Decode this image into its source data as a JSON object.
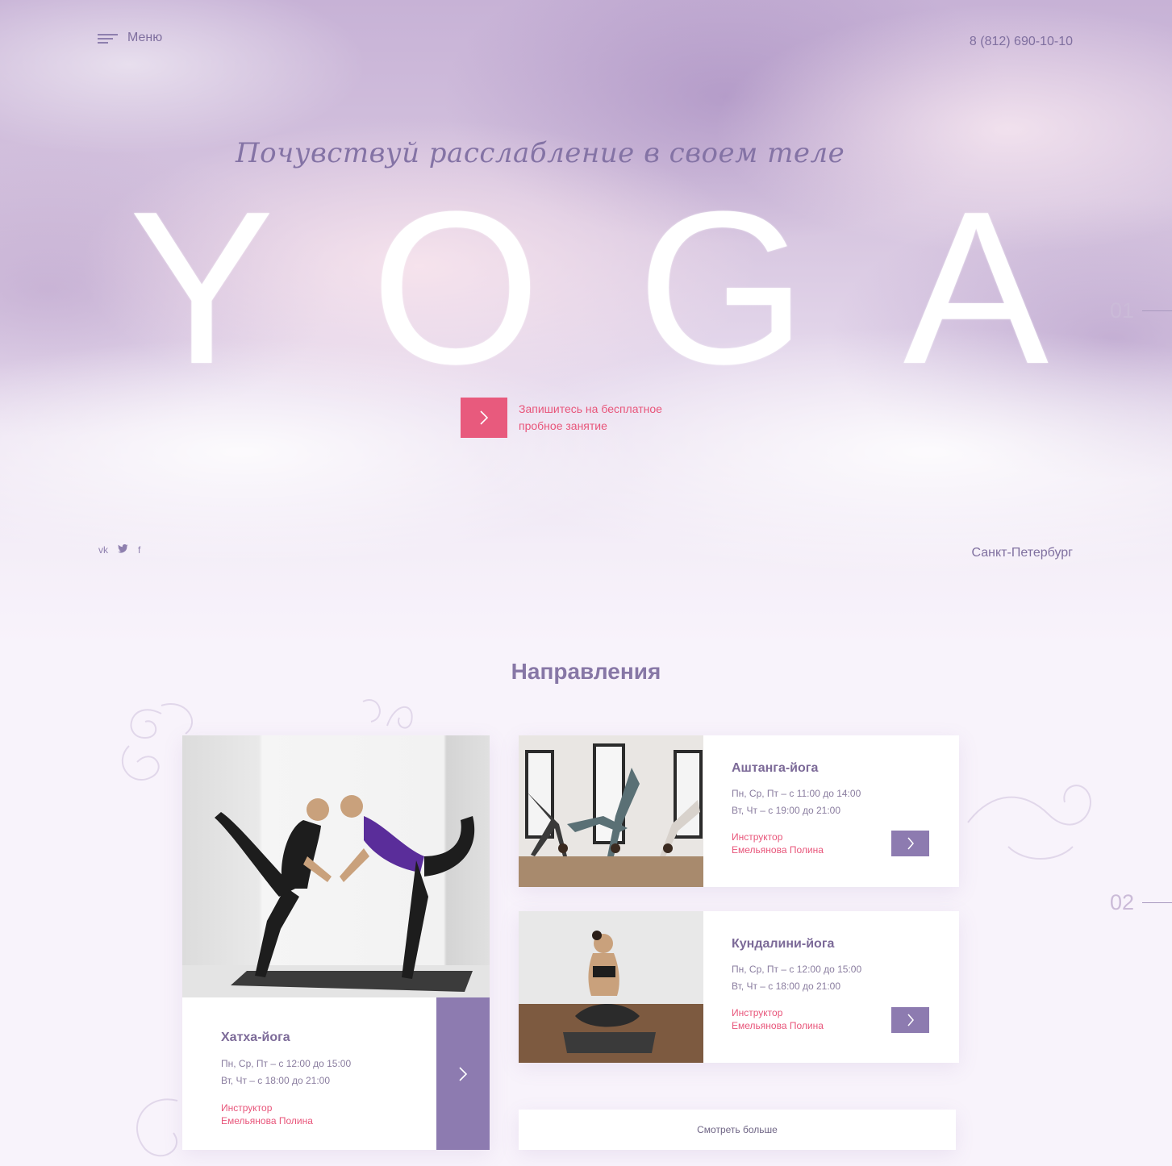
{
  "header": {
    "menu_label": "Меню",
    "phone": "8 (812) 690-10-10"
  },
  "hero": {
    "tagline": "Почувствуй расслабление в своем теле",
    "title_letters": [
      "Y",
      "O",
      "G",
      "A"
    ],
    "cta_text": "Запишитесь на бесплатное пробное занятие",
    "city": "Санкт-Петербург",
    "socials": [
      "vk",
      "twitter",
      "f"
    ]
  },
  "slide_numbers": [
    "01",
    "02"
  ],
  "directions": {
    "title": "Направления",
    "cards": [
      {
        "title": "Хатха-йога",
        "schedule": [
          "Пн, Ср, Пт – с 12:00 до 15:00",
          "Вт, Чт – с 18:00 до 21:00"
        ],
        "instructor_label": "Инструктор",
        "instructor": "Емельянова Полина"
      },
      {
        "title": "Аштанга-йога",
        "schedule": [
          "Пн, Ср, Пт – с 11:00 до 14:00",
          "Вт, Чт – с 19:00 до 21:00"
        ],
        "instructor_label": "Инструктор",
        "instructor": "Емельянова Полина"
      },
      {
        "title": "Кундалини-йога",
        "schedule": [
          "Пн, Ср, Пт – с 12:00 до 15:00",
          "Вт, Чт – с 18:00 до 21:00"
        ],
        "instructor_label": "Инструктор",
        "instructor": "Емельянова Полина"
      }
    ],
    "more_label": "Смотреть больше"
  },
  "colors": {
    "accent_pink": "#e85a7d",
    "accent_purple": "#8d7bb0",
    "heading_purple": "#8777a6"
  }
}
